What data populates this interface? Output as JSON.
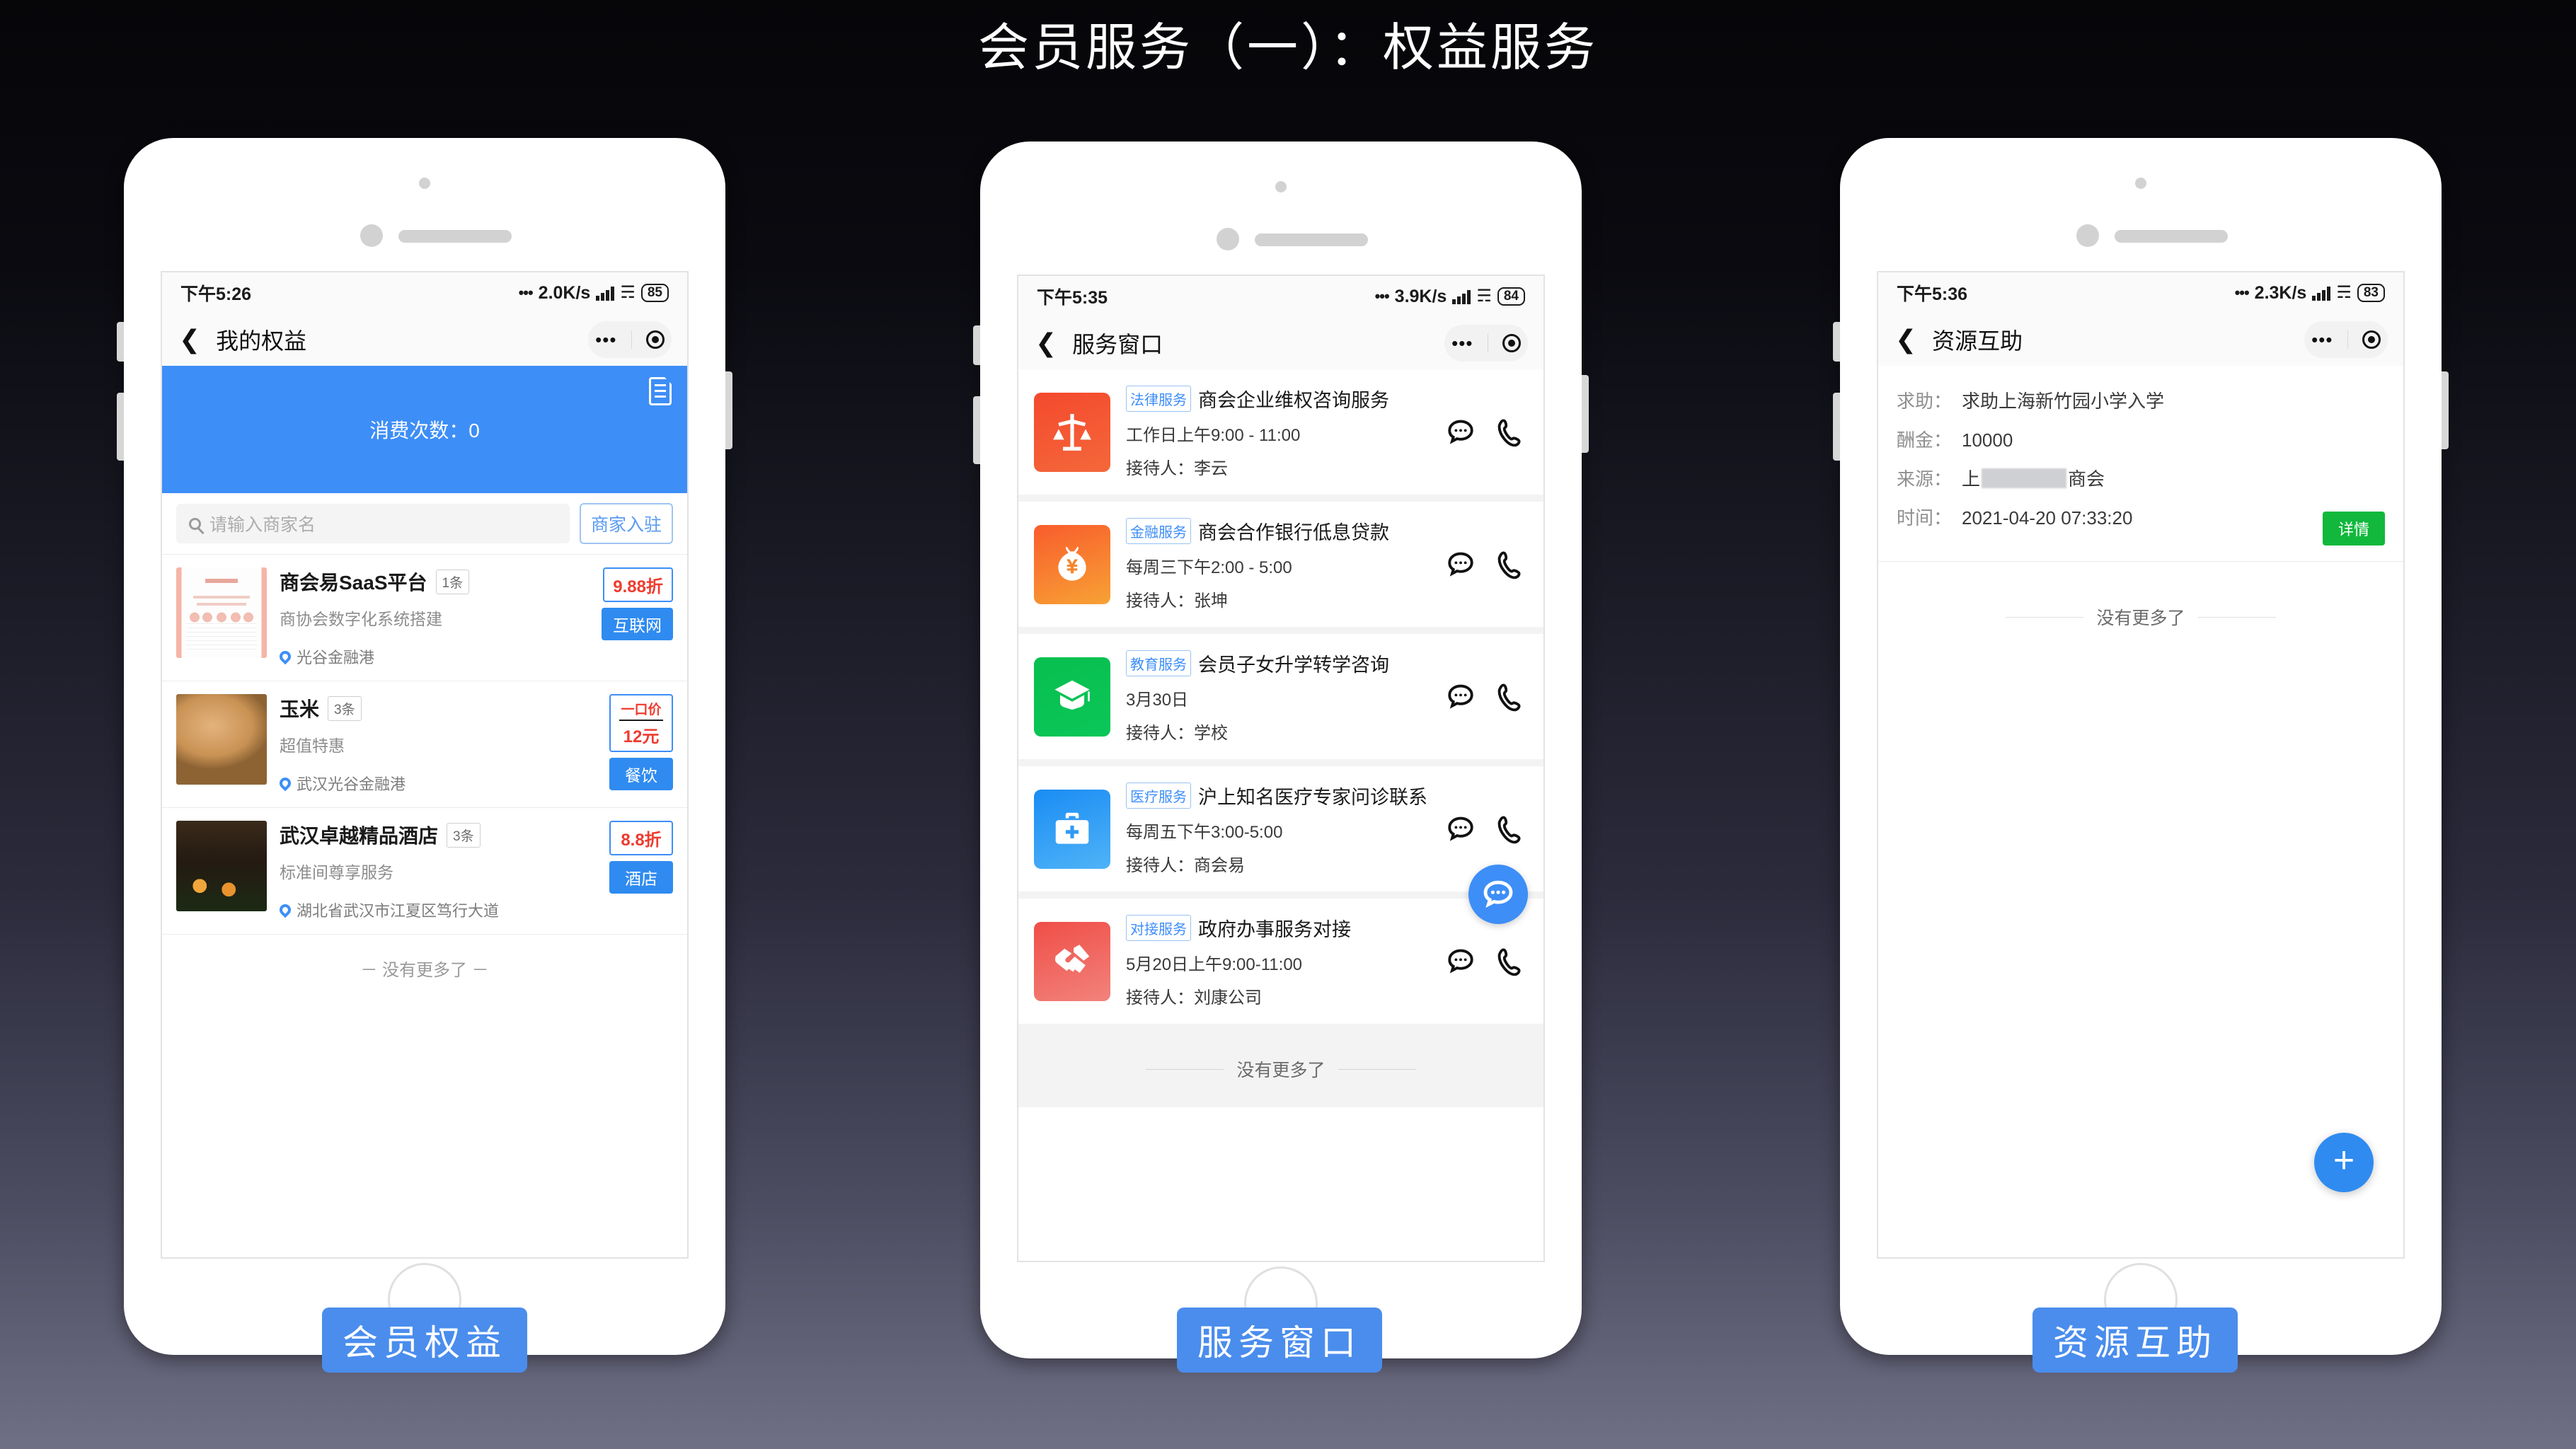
{
  "page": {
    "title": "会员服务（一）：权益服务"
  },
  "phones": [
    {
      "label": "会员权益",
      "status": {
        "time": "下午5:26",
        "net_speed": "2.0K/s",
        "battery": "85"
      },
      "nav": {
        "title": "我的权益"
      },
      "hero": {
        "text": "消费次数：0",
        "doc_icon": "document-icon"
      },
      "search": {
        "placeholder": "请输入商家名",
        "button": "商家入驻"
      },
      "merchants": [
        {
          "name": "商会易SaaS平台",
          "count": "1条",
          "desc": "商协会数字化系统搭建",
          "address": "光谷金融港",
          "price_sub": "",
          "price": "9.88折",
          "category": "互联网",
          "thumb": "document-thumbnail"
        },
        {
          "name": "玉米",
          "count": "3条",
          "desc": "超值特惠",
          "address": "武汉光谷金融港",
          "price_sub": "一口价",
          "price": "12元",
          "category": "餐饮",
          "thumb": "dog-photo-thumbnail"
        },
        {
          "name": "武汉卓越精品酒店",
          "count": "3条",
          "desc": "标准间尊享服务",
          "address": "湖北省武汉市江夏区笃行大道",
          "price_sub": "",
          "price": "8.8折",
          "category": "酒店",
          "thumb": "hotel-photo-thumbnail"
        }
      ],
      "no_more": "－ 没有更多了 －"
    },
    {
      "label": "服务窗口",
      "status": {
        "time": "下午5:35",
        "net_speed": "3.9K/s",
        "battery": "84"
      },
      "nav": {
        "title": "服务窗口"
      },
      "services": [
        {
          "badge": "法律服务",
          "name": "商会企业维权咨询服务",
          "time": "工作日上午9:00 - 11:00",
          "host": "接待人：李云",
          "icon": "scales-of-justice-icon",
          "color_start": "#f4492e",
          "color_end": "#f4683a"
        },
        {
          "badge": "金融服务",
          "name": "商会合作银行低息贷款",
          "time": "每周三下午2:00 - 5:00",
          "host": "接待人：张坤",
          "icon": "money-bag-icon",
          "color_start": "#f95c2c",
          "color_end": "#f7a235"
        },
        {
          "badge": "教育服务",
          "name": "会员子女升学转学咨询",
          "time": "3月30日",
          "host": "接待人：学校",
          "icon": "graduation-cap-icon",
          "color_start": "#07bf4e",
          "color_end": "#0bc659"
        },
        {
          "badge": "医疗服务",
          "name": "沪上知名医疗专家问诊联系",
          "time": "每周五下午3:00-5:00",
          "host": "接待人：商会易",
          "icon": "medical-kit-icon",
          "color_start": "#1a8cf3",
          "color_end": "#4fb3f7"
        },
        {
          "badge": "对接服务",
          "name": "政府办事服务对接",
          "time": "5月20日上午9:00-11:00",
          "host": "接待人：刘康公司",
          "icon": "handshake-icon",
          "color_start": "#ef4e47",
          "color_end": "#f2837c"
        }
      ],
      "fab": "chat-bubble-icon",
      "no_more": "没有更多了"
    },
    {
      "label": "资源互助",
      "status": {
        "time": "下午5:36",
        "net_speed": "2.3K/s",
        "battery": "83"
      },
      "nav": {
        "title": "资源互助"
      },
      "record": {
        "rows": [
          {
            "key": "求助：",
            "value": "求助上海新竹园小学入学"
          },
          {
            "key": "酬金：",
            "value": "10000"
          },
          {
            "key": "来源：",
            "value_prefix": "上",
            "value_suffix": "商会",
            "redacted": true
          },
          {
            "key": "时间：",
            "value": "2021-04-20 07:33:20"
          }
        ],
        "detail_button": "详情"
      },
      "fab_add": "plus-icon",
      "no_more": "没有更多了"
    }
  ],
  "colors": {
    "accent_blue": "#3d8ef7",
    "label_blue": "#4a8ded",
    "price_red": "#ef3b2f",
    "detail_green": "#11b83c"
  }
}
